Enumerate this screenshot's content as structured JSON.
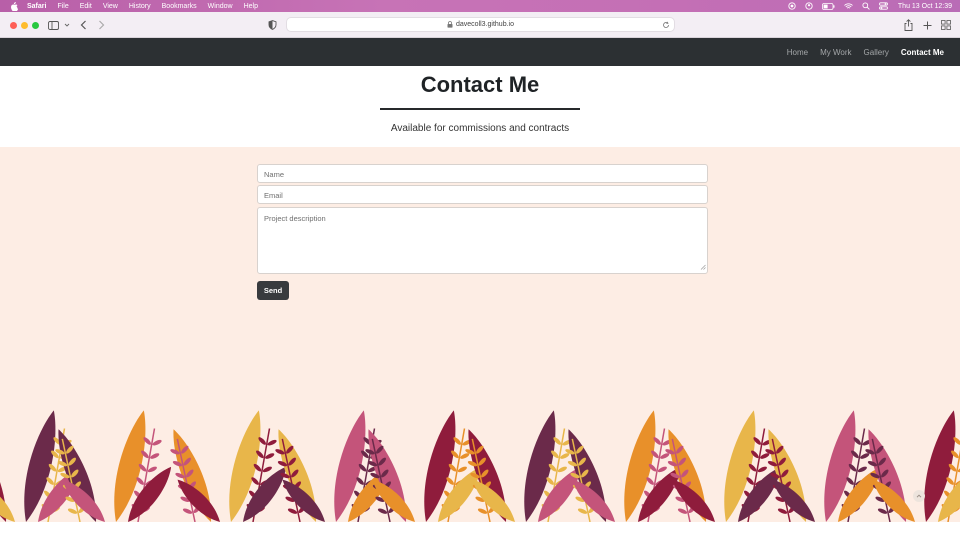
{
  "menubar": {
    "app": "Safari",
    "items": [
      "File",
      "Edit",
      "View",
      "History",
      "Bookmarks",
      "Window",
      "Help"
    ],
    "clock": "Thu 13 Oct  12:39"
  },
  "browser": {
    "url": "davecoll3.github.io"
  },
  "nav": {
    "links": [
      "Home",
      "My Work",
      "Gallery",
      "Contact Me"
    ],
    "active": "Contact Me"
  },
  "header": {
    "title": "Contact Me",
    "subtitle": "Available for commissions and contracts"
  },
  "form": {
    "name_placeholder": "Name",
    "email_placeholder": "Email",
    "description_placeholder": "Project description",
    "send_label": "Send"
  },
  "colors": {
    "navbar": "#2c3033",
    "page_background": "#fdede4",
    "button": "#383b3e",
    "leaf_crimson": "#8f1c3c",
    "leaf_plum": "#6b2a4a",
    "leaf_orange": "#e8902a",
    "leaf_gold": "#e8b64a",
    "leaf_pink": "#c4547a"
  },
  "icons": [
    "apple-icon",
    "sidebar-icon",
    "back-icon",
    "forward-icon",
    "shield-icon",
    "lock-icon",
    "reload-icon",
    "share-icon",
    "new-tab-icon",
    "tab-overview-icon",
    "wifi-icon",
    "battery-icon",
    "search-icon",
    "control-center-icon",
    "chevron-up-icon"
  ]
}
